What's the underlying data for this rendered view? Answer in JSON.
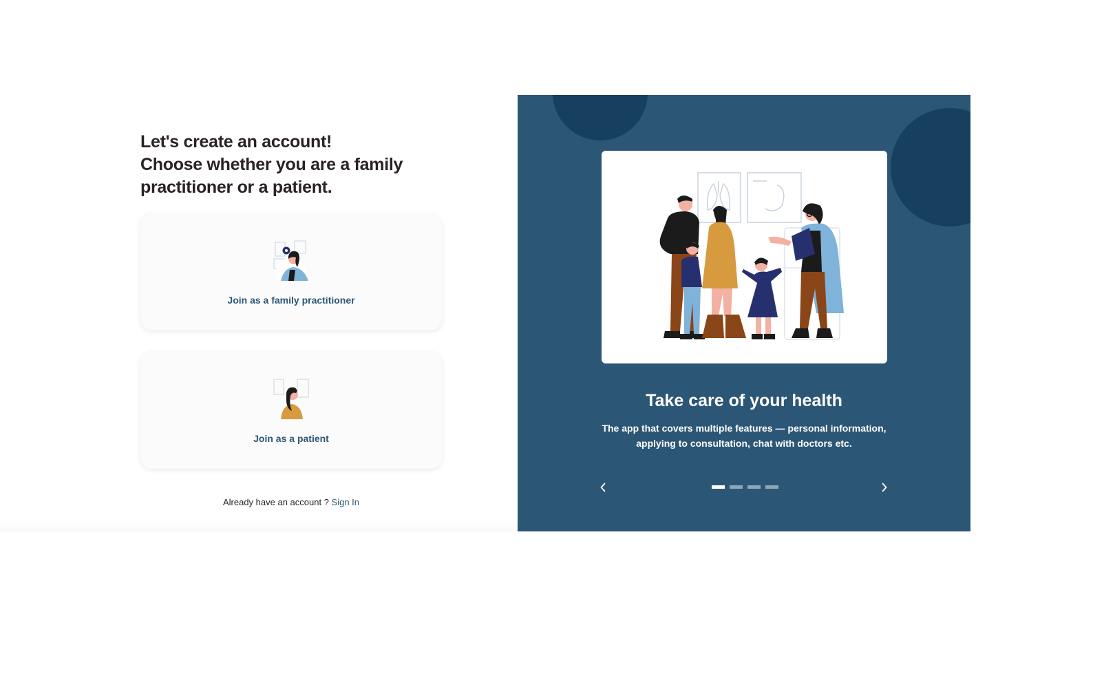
{
  "signup": {
    "heading_lines": [
      "Let's create an account!",
      "Choose whether you are a family",
      "practitioner or a patient."
    ],
    "options": [
      {
        "label": "Join as a family practitioner",
        "icon": "doctor-avatar-icon"
      },
      {
        "label": "Join as a patient",
        "icon": "patient-avatar-icon"
      }
    ],
    "signin_prompt": "Already have an account ?",
    "signin_link": "Sign In"
  },
  "carousel": {
    "title": "Take care of your health",
    "description": "The app that covers multiple features — personal information, applying to consultation, chat with doctors etc.",
    "slide_count": 4,
    "active_slide": 1,
    "prev_icon": "chevron-left-icon",
    "next_icon": "chevron-right-icon",
    "illustration": "family-with-doctor-illustration"
  },
  "colors": {
    "brand_blue": "#2c5675",
    "deep_blue": "#173f5f",
    "heading_text": "#2a2226",
    "card_bg": "#fbfbfb",
    "dot_inactive": "#8fa7ba",
    "mustard": "#d79a3f",
    "brown": "#8a4518",
    "navy": "#27306f",
    "light_blue": "#7fb3d9"
  }
}
